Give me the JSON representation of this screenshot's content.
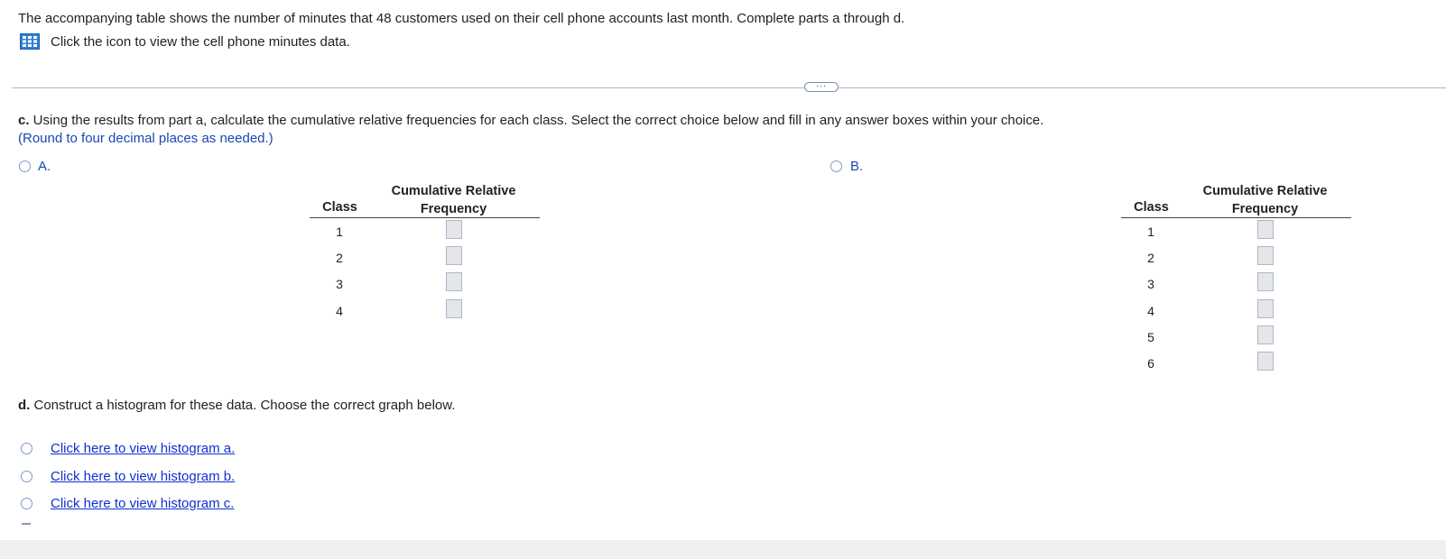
{
  "intro": "The accompanying table shows the number of minutes that 48 customers used on their cell phone accounts last month. Complete parts a through d.",
  "data_link": {
    "icon": "table-icon",
    "label": "Click the icon to view the cell phone minutes data."
  },
  "more_button": "···",
  "part_c": {
    "prefix": "c.",
    "text": " Using the results from part a, calculate the cumulative relative frequencies for each class. Select the correct choice below and fill in any answer boxes within your choice.",
    "note": "(Round to four decimal places as needed.)"
  },
  "option_a": {
    "label": "A.",
    "table": {
      "col_class": "Class",
      "col_crf_line1": "Cumulative Relative",
      "col_crf_line2": "Frequency",
      "rows": [
        "1",
        "2",
        "3",
        "4"
      ]
    }
  },
  "option_b": {
    "label": "B.",
    "table": {
      "col_class": "Class",
      "col_crf_line1": "Cumulative Relative",
      "col_crf_line2": "Frequency",
      "rows": [
        "1",
        "2",
        "3",
        "4",
        "5",
        "6"
      ]
    }
  },
  "part_d": {
    "prefix": "d.",
    "text": " Construct a histogram for these data. Choose the correct graph below.",
    "links": [
      "Click here to view histogram a.",
      "Click here to view histogram b.",
      "Click here to view histogram c."
    ]
  }
}
